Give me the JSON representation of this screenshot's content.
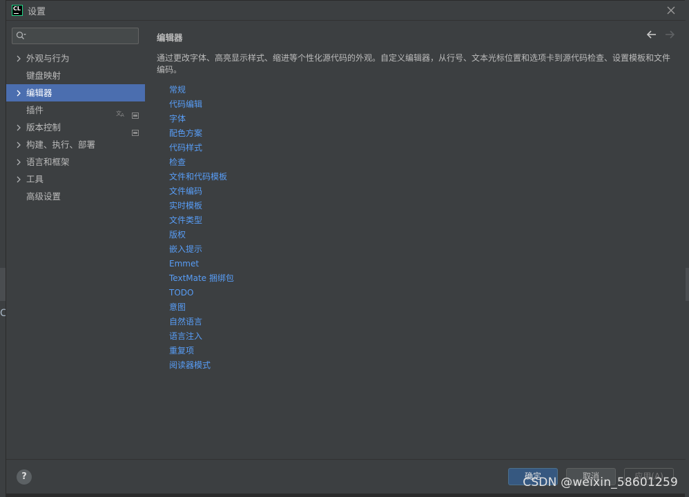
{
  "window": {
    "title": "设置",
    "app_icon_text": "CL"
  },
  "search": {
    "placeholder": "",
    "value": ""
  },
  "sidebar": {
    "items": [
      {
        "label": "外观与行为",
        "expandable": true
      },
      {
        "label": "键盘映射",
        "expandable": false
      },
      {
        "label": "编辑器",
        "expandable": true,
        "selected": true
      },
      {
        "label": "插件",
        "expandable": false
      },
      {
        "label": "版本控制",
        "expandable": true
      },
      {
        "label": "构建、执行、部署",
        "expandable": true
      },
      {
        "label": "语言和框架",
        "expandable": true
      },
      {
        "label": "工具",
        "expandable": true
      },
      {
        "label": "高级设置",
        "expandable": false
      }
    ]
  },
  "content": {
    "title": "编辑器",
    "description": "通过更改字体、高亮显示样式、缩进等个性化源代码的外观。自定义编辑器，从行号、文本光标位置和选项卡到源代码检查、设置模板和文件编码。",
    "links": [
      "常规",
      "代码编辑",
      "字体",
      "配色方案",
      "代码样式",
      "检查",
      "文件和代码模板",
      "文件编码",
      "实时模板",
      "文件类型",
      "版权",
      "嵌入提示",
      "Emmet",
      "TextMate 捆绑包",
      "TODO",
      "意图",
      "自然语言",
      "语言注入",
      "重复项",
      "阅读器模式"
    ]
  },
  "footer": {
    "help_label": "?",
    "ok_label": "确定",
    "cancel_label": "取消",
    "apply_label": "应用(A)"
  },
  "watermark": "CSDN @weixin_58601259",
  "backdrop": {
    "left_glyph": "C"
  },
  "colors": {
    "background": "#3c3f41",
    "selection": "#4b6eaf",
    "link": "#589df6",
    "primary_button": "#365880"
  }
}
